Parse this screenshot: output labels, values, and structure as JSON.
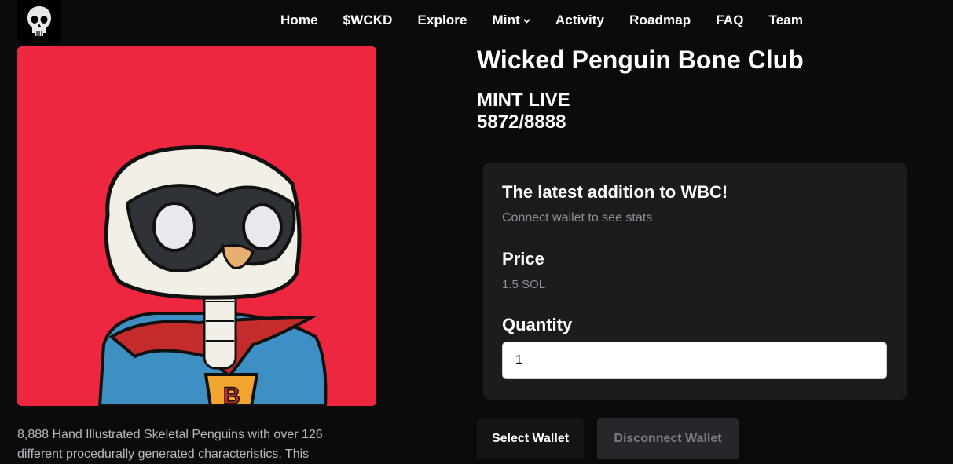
{
  "nav": {
    "items": [
      {
        "label": "Home"
      },
      {
        "label": "$WCKD"
      },
      {
        "label": "Explore"
      },
      {
        "label": "Mint",
        "has_dropdown": true
      },
      {
        "label": "Activity"
      },
      {
        "label": "Roadmap"
      },
      {
        "label": "FAQ"
      },
      {
        "label": "Team"
      }
    ],
    "logo_icon": "skull-icon"
  },
  "hero": {
    "image_icon": "skeletal-penguin-superhero-art",
    "background_color": "#ee2740",
    "description": "8,888 Hand Illustrated Skeletal Penguins with over 126 different procedurally generated characteristics. This"
  },
  "collection": {
    "title": "Wicked Penguin Bone Club",
    "status": "MINT LIVE",
    "minted": "5872/8888"
  },
  "mint_card": {
    "heading": "The latest addition to WBC!",
    "subheading": "Connect wallet to see stats",
    "price_label": "Price",
    "price_value": "1.5 SOL",
    "quantity_label": "Quantity",
    "quantity_value": "1"
  },
  "wallet": {
    "select_label": "Select Wallet",
    "disconnect_label": "Disconnect Wallet"
  }
}
